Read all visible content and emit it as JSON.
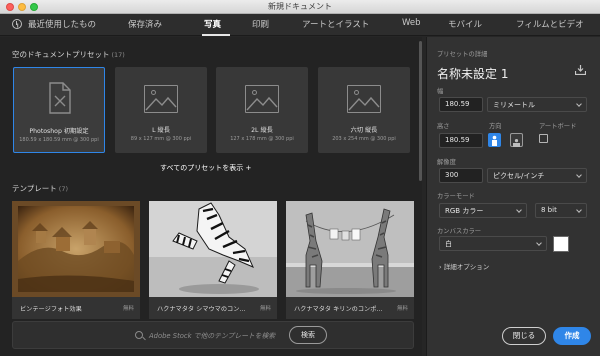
{
  "window": {
    "title": "新規ドキュメント"
  },
  "tabs": [
    {
      "label": "最近使用したもの"
    },
    {
      "label": "保存済み"
    },
    {
      "label": "写真"
    },
    {
      "label": "印刷"
    },
    {
      "label": "アートとイラスト"
    },
    {
      "label": "Web"
    },
    {
      "label": "モバイル"
    },
    {
      "label": "フィルムとビデオ"
    }
  ],
  "active_tab": "写真",
  "blank_presets": {
    "title": "空のドキュメントプリセット",
    "count": "(17)",
    "items": [
      {
        "name": "Photoshop 初期設定",
        "size": "180.59 x 180.59 mm @ 300 ppi",
        "selected": true
      },
      {
        "name": "L 縦長",
        "size": "89 x 127 mm @ 300 ppi"
      },
      {
        "name": "2L 縦長",
        "size": "127 x 178 mm @ 300 ppi"
      },
      {
        "name": "六切 縦長",
        "size": "203 x 254 mm @ 300 ppi"
      }
    ],
    "show_all": "すべてのプリセットを表示 +"
  },
  "templates": {
    "title": "テンプレート",
    "count": "(7)",
    "items": [
      {
        "name": "ビンテージフォト効果",
        "badge": "無料"
      },
      {
        "name": "ハクナマタタ シマウマのコン...",
        "badge": "無料"
      },
      {
        "name": "ハクナマタタ キリンのコンポ...",
        "badge": "無料"
      }
    ]
  },
  "search": {
    "placeholder": "Adobe Stock で他のテンプレートを検索",
    "button": "検索"
  },
  "details": {
    "header": "プリセットの詳細",
    "doc_name": "名称未設定 1",
    "width_label": "幅",
    "width_value": "180.59",
    "width_unit": "ミリメートル",
    "height_label": "高さ",
    "height_value": "180.59",
    "orientation_label": "方向",
    "artboard_label": "アートボード",
    "resolution_label": "解像度",
    "resolution_value": "300",
    "resolution_unit": "ピクセル/インチ",
    "color_mode_label": "カラーモード",
    "color_mode_value": "RGB カラー",
    "bit_depth": "8 bit",
    "canvas_color_label": "カンバスカラー",
    "canvas_color_value": "白",
    "advanced": "詳細オプション",
    "close_button": "閉じる",
    "create_button": "作成"
  },
  "colors": {
    "accent": "#2f86e8",
    "background": "#232323",
    "panel": "#323232"
  }
}
